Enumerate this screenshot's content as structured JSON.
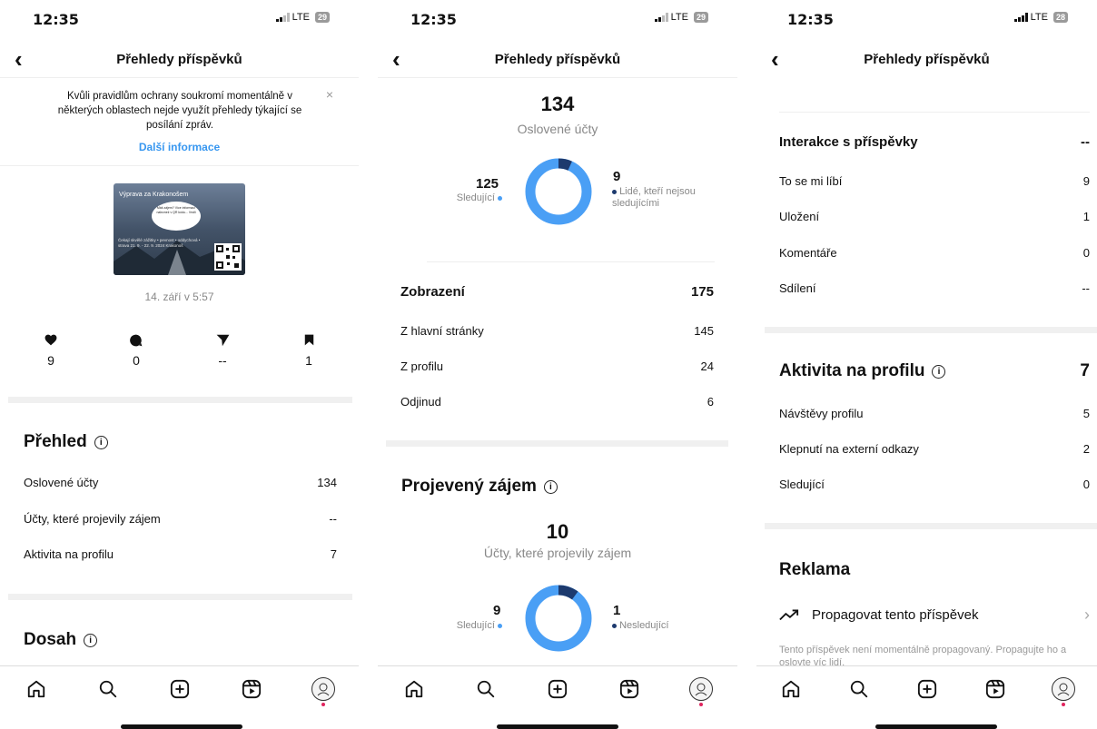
{
  "status": {
    "time": "12:35",
    "network": "LTE",
    "battery_a": "29",
    "battery_c": "28"
  },
  "header": {
    "title": "Přehledy příspěvků"
  },
  "colors": {
    "accent": "#4a9ff5",
    "dark_blue": "#1d3a6e",
    "link": "#3897f0"
  },
  "screen1": {
    "notice": {
      "text": "Kvůli pravidlům ochrany soukromí momentálně v některých oblastech nejde využít přehledy týkající se posílání zpráv.",
      "link": "Další informace"
    },
    "post": {
      "image_title": "Výprava za Krakonošem",
      "image_bubble": "Máš zájem? Více informací naleznež v QR kódu... Vrstli",
      "image_footer": "Čekají skvělé zážitky • pevnost • oddychová • strava 21. 9. - 22. 9. 2024 Krakonoš",
      "date": "14. září v 5:57"
    },
    "stats": [
      {
        "icon": "heart-icon",
        "value": "9"
      },
      {
        "icon": "comment-icon",
        "value": "0"
      },
      {
        "icon": "send-icon",
        "value": "--"
      },
      {
        "icon": "bookmark-icon",
        "value": "1"
      }
    ],
    "overview": {
      "title": "Přehled",
      "rows": [
        {
          "label": "Oslovené účty",
          "value": "134"
        },
        {
          "label": "Účty, které projevily zájem",
          "value": "--"
        },
        {
          "label": "Aktivita na profilu",
          "value": "7"
        }
      ]
    },
    "reach_title": "Dosah"
  },
  "screen2": {
    "reach": {
      "value": "134",
      "label": "Oslovené účty",
      "followers_value": "125",
      "followers_label": "Sledující",
      "nonfollowers_value": "9",
      "nonfollowers_label": "Lidé, kteří nejsou sledujícími",
      "followers_fraction": 0.933
    },
    "views": {
      "title": "Zobrazení",
      "total": "175",
      "rows": [
        {
          "label": "Z hlavní stránky",
          "value": "145"
        },
        {
          "label": "Z profilu",
          "value": "24"
        },
        {
          "label": "Odjinud",
          "value": "6"
        }
      ]
    },
    "engagement": {
      "title": "Projevený zájem",
      "value": "10",
      "label": "Účty, které projevily zájem",
      "followers_value": "9",
      "followers_label": "Sledující",
      "nonfollowers_value": "1",
      "nonfollowers_label": "Nesledující",
      "followers_fraction": 0.9
    }
  },
  "screen3": {
    "interactions": {
      "title": "Interakce s příspěvky",
      "total": "--",
      "rows": [
        {
          "label": "To se mi líbí",
          "value": "9"
        },
        {
          "label": "Uložení",
          "value": "1"
        },
        {
          "label": "Komentáře",
          "value": "0"
        },
        {
          "label": "Sdílení",
          "value": "--"
        }
      ]
    },
    "profile_activity": {
      "title": "Aktivita na profilu",
      "total": "7",
      "rows": [
        {
          "label": "Návštěvy profilu",
          "value": "5"
        },
        {
          "label": "Klepnutí na externí odkazy",
          "value": "2"
        },
        {
          "label": "Sledující",
          "value": "0"
        }
      ]
    },
    "ads": {
      "title": "Reklama",
      "promote_label": "Propagovat tento příspěvek",
      "note": "Tento příspěvek není momentálně propagovaný. Propagujte ho a oslovte víc lidí."
    }
  },
  "tabbar": [
    "home-icon",
    "search-icon",
    "create-icon",
    "reels-icon",
    "profile-avatar"
  ]
}
